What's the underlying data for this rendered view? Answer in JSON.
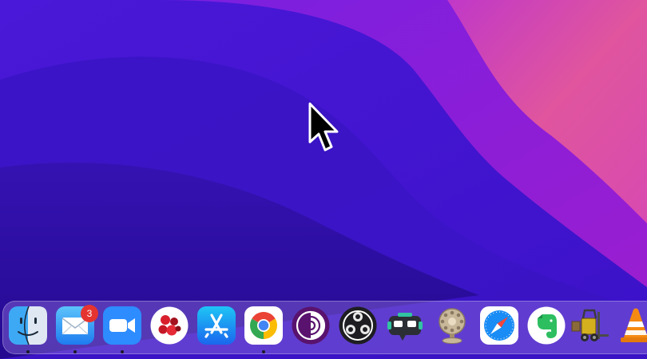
{
  "wallpaper": {
    "name": "macOS Monterey",
    "colors": {
      "deep": "#2a0f9a",
      "mid": "#4a17d6",
      "violet": "#7a1fe0",
      "magenta": "#c21dc0",
      "pink": "#e24aa0"
    }
  },
  "dock": {
    "items": [
      {
        "name": "finder",
        "icon": "finder-icon",
        "running": true
      },
      {
        "name": "mail",
        "icon": "mail-icon",
        "running": true,
        "badge": "3"
      },
      {
        "name": "zoom",
        "icon": "video-camera-icon",
        "running": true
      },
      {
        "name": "scrobbles",
        "icon": "red-circles-icon",
        "running": false
      },
      {
        "name": "app-store",
        "icon": "app-store-icon",
        "running": false
      },
      {
        "name": "chrome",
        "icon": "chrome-icon",
        "running": true
      },
      {
        "name": "tor-browser",
        "icon": "tor-onion-icon",
        "running": false
      },
      {
        "name": "obs",
        "icon": "obs-icon",
        "running": false
      },
      {
        "name": "streamlabs",
        "icon": "streamlabs-icon",
        "running": false
      },
      {
        "name": "microphone-app",
        "icon": "microphone-icon",
        "running": false
      },
      {
        "name": "safari",
        "icon": "compass-icon",
        "running": false
      },
      {
        "name": "evernote",
        "icon": "elephant-icon",
        "running": false
      },
      {
        "name": "forklift",
        "icon": "forklift-icon",
        "running": false
      },
      {
        "name": "vlc",
        "icon": "traffic-cone-icon",
        "running": false
      }
    ]
  }
}
